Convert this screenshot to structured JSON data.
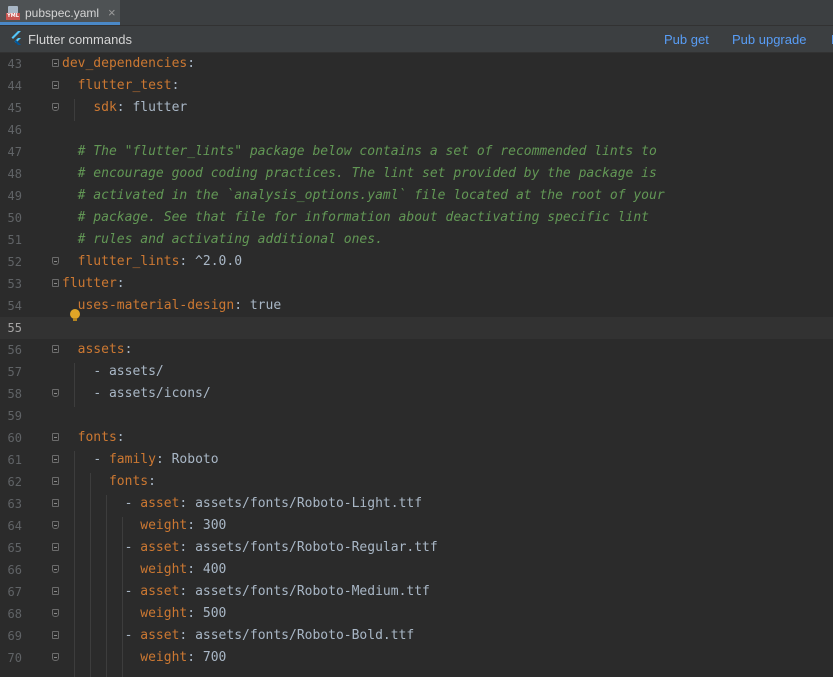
{
  "tab": {
    "filename": "pubspec.yaml",
    "icon": "yaml-file-icon",
    "close": "×"
  },
  "toolbar": {
    "title": "Flutter commands",
    "pub_get": "Pub get",
    "pub_upgrade": "Pub upgrade",
    "more": "F"
  },
  "colors": {
    "key": "#cc7832",
    "comment": "#629755",
    "text": "#a9b7c6",
    "link": "#589df6"
  },
  "editor": {
    "current_line": 55,
    "lines": [
      {
        "n": "43",
        "key": "dev_dependencies",
        "rest": ":"
      },
      {
        "n": "44",
        "indent": "  ",
        "key": "flutter_test",
        "rest": ":"
      },
      {
        "n": "45",
        "indent": "    ",
        "key": "sdk",
        "rest": ": flutter"
      },
      {
        "n": "46"
      },
      {
        "n": "47",
        "indent": "  ",
        "comment": "# The \"flutter_lints\" package below contains a set of recommended lints to"
      },
      {
        "n": "48",
        "indent": "  ",
        "comment": "# encourage good coding practices. The lint set provided by the package is"
      },
      {
        "n": "49",
        "indent": "  ",
        "comment": "# activated in the `analysis_options.yaml` file located at the root of your"
      },
      {
        "n": "50",
        "indent": "  ",
        "comment": "# package. See that file for information about deactivating specific lint"
      },
      {
        "n": "51",
        "indent": "  ",
        "comment": "# rules and activating additional ones."
      },
      {
        "n": "52",
        "indent": "  ",
        "key": "flutter_lints",
        "rest": ": ^2.0.0"
      },
      {
        "n": "53",
        "key": "flutter",
        "rest": ":"
      },
      {
        "n": "54",
        "indent": "  ",
        "key": "uses-material-design",
        "rest": ": true"
      },
      {
        "n": "55"
      },
      {
        "n": "56",
        "indent": "  ",
        "key": "assets",
        "rest": ":"
      },
      {
        "n": "57",
        "indent": "    ",
        "pre": "- ",
        "rest": "assets/"
      },
      {
        "n": "58",
        "indent": "    ",
        "pre": "- ",
        "rest": "assets/icons/"
      },
      {
        "n": "59"
      },
      {
        "n": "60",
        "indent": "  ",
        "key": "fonts",
        "rest": ":"
      },
      {
        "n": "61",
        "indent": "    ",
        "pre": "- ",
        "key": "family",
        "rest": ": Roboto"
      },
      {
        "n": "62",
        "indent": "      ",
        "key": "fonts",
        "rest": ":"
      },
      {
        "n": "63",
        "indent": "        ",
        "pre": "- ",
        "key": "asset",
        "rest": ": assets/fonts/Roboto-Light.ttf"
      },
      {
        "n": "64",
        "indent": "          ",
        "key": "weight",
        "rest": ": 300"
      },
      {
        "n": "65",
        "indent": "        ",
        "pre": "- ",
        "key": "asset",
        "rest": ": assets/fonts/Roboto-Regular.ttf"
      },
      {
        "n": "66",
        "indent": "          ",
        "key": "weight",
        "rest": ": 400"
      },
      {
        "n": "67",
        "indent": "        ",
        "pre": "- ",
        "key": "asset",
        "rest": ": assets/fonts/Roboto-Medium.ttf"
      },
      {
        "n": "68",
        "indent": "          ",
        "key": "weight",
        "rest": ": 500"
      },
      {
        "n": "69",
        "indent": "        ",
        "pre": "- ",
        "key": "asset",
        "rest": ": assets/fonts/Roboto-Bold.ttf"
      },
      {
        "n": "70",
        "indent": "          ",
        "key": "weight",
        "rest": ": 700"
      }
    ]
  }
}
